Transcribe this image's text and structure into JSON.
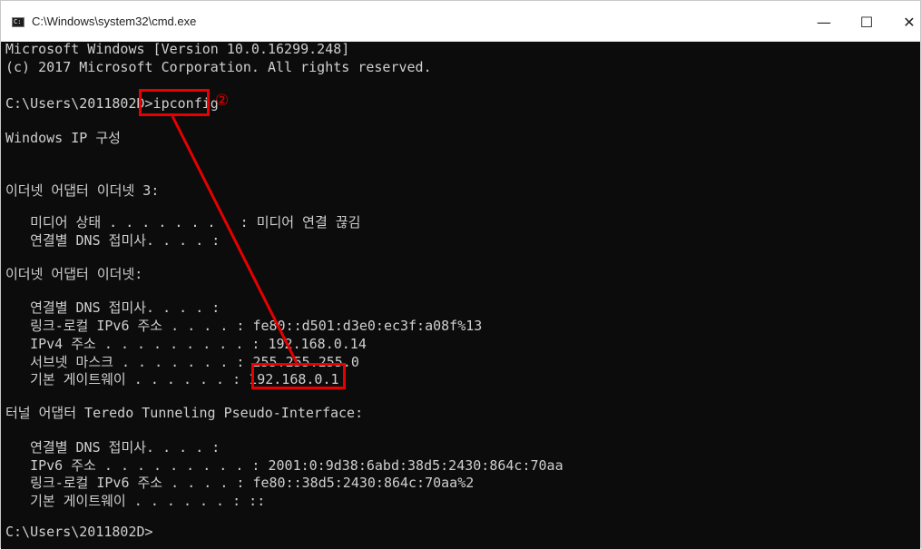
{
  "window": {
    "title": "C:\\Windows\\system32\\cmd.exe",
    "controls": {
      "minimize": "—",
      "maximize": "☐",
      "close": "✕"
    }
  },
  "console": {
    "lines": [
      "Microsoft Windows [Version 10.0.16299.248]",
      "(c) 2017 Microsoft Corporation. All rights reserved.",
      "C:\\Users\\2011802D>ipconfig",
      "Windows IP 구성",
      "이더넷 어댑터 이더넷 3:",
      "   미디어 상태 . . . . . . . . : 미디어 연결 끊김",
      "   연결별 DNS 접미사. . . . :",
      "이더넷 어댑터 이더넷:",
      "   연결별 DNS 접미사. . . . :",
      "   링크-로컬 IPv6 주소 . . . . : fe80::d501:d3e0:ec3f:a08f%13",
      "   IPv4 주소 . . . . . . . . . : 192.168.0.14",
      "   서브넷 마스크 . . . . . . . : 255.255.255.0",
      "   기본 게이트웨이 . . . . . . : 192.168.0.1",
      "터널 어댑터 Teredo Tunneling Pseudo-Interface:",
      "   연결별 DNS 접미사. . . . :",
      "   IPv6 주소 . . . . . . . . . : 2001:0:9d38:6abd:38d5:2430:864c:70aa",
      "   링크-로컬 IPv6 주소 . . . . : fe80::38d5:2430:864c:70aa%2",
      "   기본 게이트웨이 . . . . . . : ::",
      "C:\\Users\\2011802D>"
    ]
  },
  "annotation": {
    "step_label": "②",
    "color": "#e60000"
  }
}
